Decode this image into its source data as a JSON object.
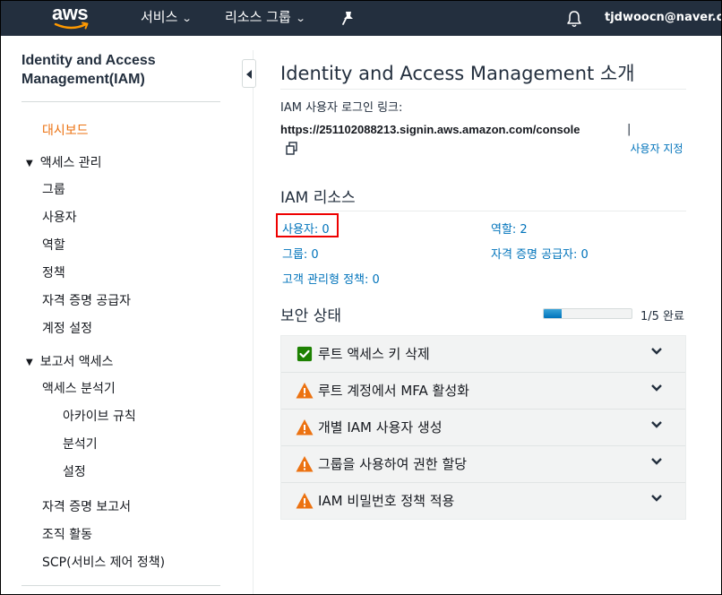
{
  "topnav": {
    "logo": "aws",
    "services": "서비스",
    "resource_groups": "리소스 그룹",
    "pin_icon": "pushpin-icon",
    "bell_icon": "bell-icon",
    "account": "tjdwoocn@naver.com"
  },
  "sidebar": {
    "title": "Identity and Access Management(IAM)",
    "dashboard": "대시보드",
    "access_management": "액세스 관리",
    "groups": "그룹",
    "users": "사용자",
    "roles": "역할",
    "policies": "정책",
    "identity_providers": "자격 증명 공급자",
    "account_settings": "계정 설정",
    "access_reports": "보고서 액세스",
    "access_analyzer": "액세스 분석기",
    "archive_rules": "아카이브 규칙",
    "analyzers": "분석기",
    "settings": "설정",
    "credential_report": "자격 증명 보고서",
    "org_activity": "조직 활동",
    "scp": "SCP(서비스 제어 정책)"
  },
  "main": {
    "title": "Identity and Access Management 소개",
    "signin_label": "IAM 사용자 로그인 링크:",
    "signin_url": "https://251102088213.signin.aws.amazon.com/console",
    "pipe": "|",
    "customize": "사용자 지정",
    "resources_title": "IAM 리소스",
    "resources": {
      "users": "사용자: 0",
      "roles": "역할: 2",
      "groups": "그룹: 0",
      "identity_providers": "자격 증명 공급자: 0",
      "customer_policies": "고객 관리형 정책: 0"
    },
    "security_title": "보안 상태",
    "progress": {
      "completed": 1,
      "total": 5,
      "fraction": 0.2,
      "text": "1/5 완료"
    },
    "security_items": [
      {
        "label": "루트 액세스 키 삭제",
        "status": "complete",
        "icon": "check-icon"
      },
      {
        "label": "루트 계정에서 MFA 활성화",
        "status": "warning",
        "icon": "warning-icon"
      },
      {
        "label": "개별 IAM 사용자 생성",
        "status": "warning",
        "icon": "warning-icon"
      },
      {
        "label": "그룹을 사용하여 권한 할당",
        "status": "warning",
        "icon": "warning-icon"
      },
      {
        "label": "IAM 비밀번호 정책 적용",
        "status": "warning",
        "icon": "warning-icon"
      }
    ]
  },
  "colors": {
    "nav_bg": "#232f3e",
    "link": "#0073bb",
    "active": "#ec7211",
    "check": "#1d8102",
    "warning": "#ec7211",
    "highlight": "#ee0000"
  }
}
